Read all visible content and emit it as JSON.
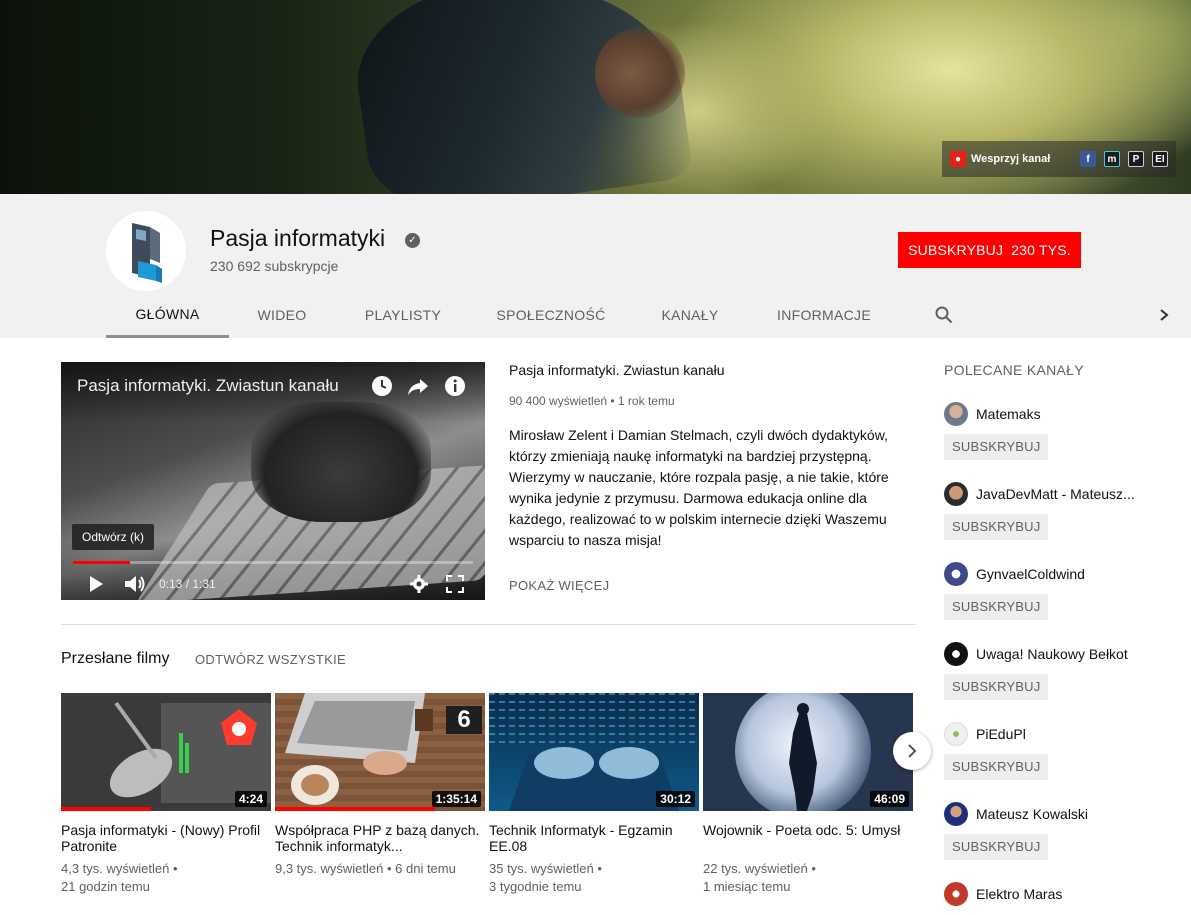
{
  "banner": {
    "links": [
      {
        "label": "Wesprzyj kanał",
        "icon": "patronite-icon",
        "color": "#e62117"
      },
      {
        "label": "",
        "icon": "facebook-icon",
        "color": "#3b5998"
      },
      {
        "label": "",
        "icon": "m-icon",
        "color": "#1b1b1b"
      },
      {
        "label": "",
        "icon": "p-icon",
        "color": "#1b1b1b"
      },
      {
        "label": "",
        "icon": "ei-icon",
        "color": "#1b1b1b"
      }
    ]
  },
  "channel": {
    "name": "Pasja informatyki",
    "subscribers": "230 692 subskrypcje",
    "subscribe_label": "SUBSKRYBUJ",
    "subscribe_count": "230 TYS.",
    "accent": "#ff0000"
  },
  "tabs": [
    {
      "label": "GŁÓWNA",
      "active": true
    },
    {
      "label": "WIDEO"
    },
    {
      "label": "PLAYLISTY"
    },
    {
      "label": "SPOŁECZNOŚĆ"
    },
    {
      "label": "KANAŁY"
    },
    {
      "label": "INFORMACJE"
    }
  ],
  "featured": {
    "overlay_title": "Pasja informatyki. Zwiastun kanału",
    "tooltip": "Odtwórz (k)",
    "time": "0:13 / 1:31",
    "progress": 0.143,
    "title": "Pasja informatyki. Zwiastun kanału",
    "meta": "90 400 wyświetleń • 1 rok temu",
    "description": "Mirosław Zelent i Damian Stelmach, czyli dwóch dydaktyków, którzy zmieniają naukę informatyki na bardziej przystępną. Wierzymy w nauczanie, które rozpala pasję, a nie takie, które wynika jedynie z przymusu. Darmowa edukacja online dla każdego, realizować to w polskim internecie dzięki Waszemu wsparciu to nasza misja!",
    "show_more": "POKAŻ WIĘCEJ"
  },
  "uploads": {
    "title": "Przesłane filmy",
    "play_all": "ODTWÓRZ WSZYSTKIE",
    "videos": [
      {
        "title": "Pasja informatyki - (Nowy) Profil Patronite",
        "views": "4,3 tys. wyświetleń •",
        "age": "21 godzin temu",
        "duration": "4:24",
        "watched": 0.43
      },
      {
        "title": "Współpraca PHP z bazą danych. Technik informatyk...",
        "views": "9,3 tys. wyświetleń • 6 dni temu",
        "age": "",
        "duration": "1:35:14",
        "watched": 0.76,
        "badge": "6"
      },
      {
        "title": "Technik Informatyk - Egzamin EE.08",
        "views": "35 tys. wyświetleń •",
        "age": "3 tygodnie temu",
        "duration": "30:12",
        "watched": 0
      },
      {
        "title": "Wojownik - Poeta odc. 5: Umysł",
        "views": "22 tys. wyświetleń •",
        "age": "1 miesiąc temu",
        "duration": "46:09",
        "watched": 0
      }
    ]
  },
  "sidebar": {
    "title": "POLECANE KANAŁY",
    "subscribe_label": "SUBSKRYBUJ",
    "channels": [
      {
        "name": "Matemaks"
      },
      {
        "name": "JavaDevMatt - Mateusz..."
      },
      {
        "name": "GynvaelColdwind"
      },
      {
        "name": "Uwaga! Naukowy Bełkot"
      },
      {
        "name": "PiEduPl"
      },
      {
        "name": "Mateusz Kowalski"
      },
      {
        "name": "Elektro Maras"
      }
    ]
  }
}
